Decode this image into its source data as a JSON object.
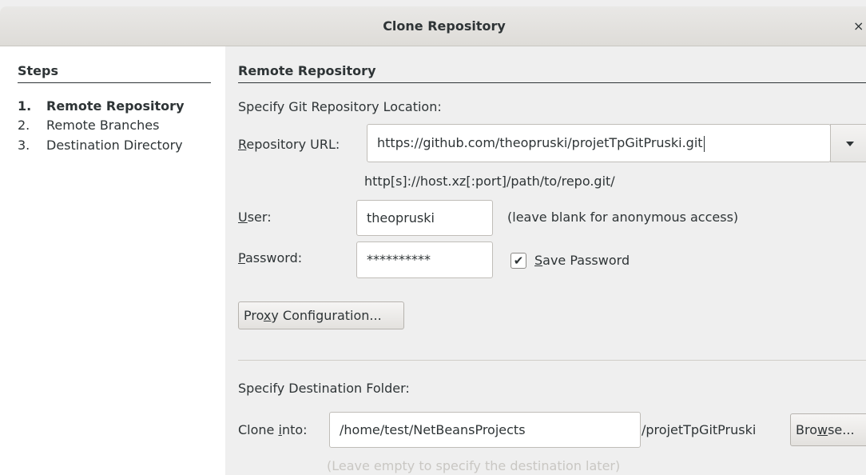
{
  "window": {
    "title": "Clone Repository",
    "close_glyph": "×"
  },
  "steps": {
    "heading": "Steps",
    "items": [
      {
        "number": "1.",
        "label": "Remote Repository",
        "active": true
      },
      {
        "number": "2.",
        "label": "Remote Branches",
        "active": false
      },
      {
        "number": "3.",
        "label": "Destination Directory",
        "active": false
      }
    ]
  },
  "remote": {
    "section_title": "Remote Repository",
    "location_label": "Specify Git Repository Location:",
    "url_label_mnemonic": "R",
    "url_label_rest": "epository URL:",
    "url_value": "https://github.com/theopruski/projetTpGitPruski.git",
    "url_hint": "http[s]://host.xz[:port]/path/to/repo.git/",
    "user_label_mnemonic": "U",
    "user_label_rest": "ser:",
    "user_value": "theopruski",
    "user_hint": "(leave blank for anonymous access)",
    "password_label_mnemonic": "P",
    "password_label_rest": "assword:",
    "password_value": "**********",
    "save_password_mnemonic": "S",
    "save_password_rest": "ave Password",
    "save_password_checked": true,
    "proxy_button_pre": "Pro",
    "proxy_button_mnemonic": "x",
    "proxy_button_post": "y Configuration..."
  },
  "destination": {
    "section_label": "Specify Destination Folder:",
    "clone_label_pre": "Clone ",
    "clone_label_mnemonic": "i",
    "clone_label_post": "nto:",
    "clone_value": "/home/test/NetBeansProjects",
    "repo_suffix": "/projetTpGitPruski",
    "browse_pre": "Bro",
    "browse_mnemonic": "w",
    "browse_post": "se...",
    "empty_hint": "(Leave empty to specify the destination later)"
  },
  "icons": {
    "close": "close-icon",
    "dropdown": "chevron-down-icon",
    "check": "checkmark-icon"
  },
  "colors": {
    "panel_bg": "#efefef",
    "steps_bg": "#ffffff",
    "text": "#2e3436",
    "faded_text": "#c9c7c3"
  }
}
